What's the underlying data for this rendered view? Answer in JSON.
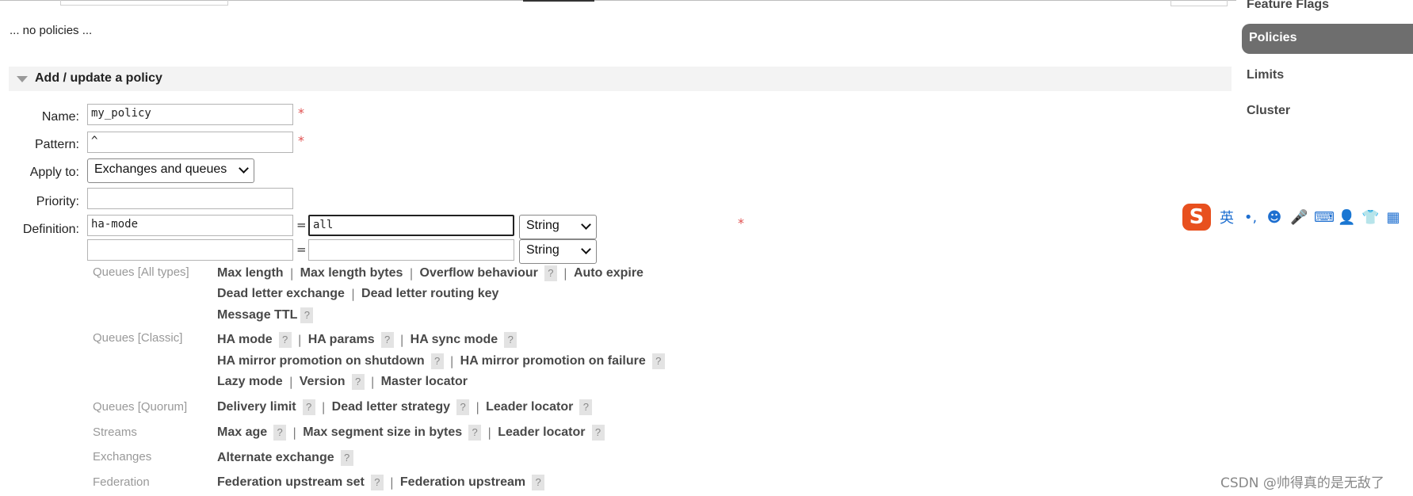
{
  "top_partial_text": "(pagination)",
  "no_policies_text": "... no policies ...",
  "section": {
    "title": "Add / update a policy"
  },
  "form": {
    "name": {
      "label": "Name:",
      "value": "my_policy",
      "required": "*"
    },
    "pattern": {
      "label": "Pattern:",
      "value": "^",
      "required": "*"
    },
    "apply_to": {
      "label": "Apply to:",
      "value": "Exchanges and queues"
    },
    "priority": {
      "label": "Priority:",
      "value": ""
    },
    "definition": {
      "label": "Definition:",
      "required": "*",
      "rows": [
        {
          "key": "ha-mode",
          "eq": "=",
          "value": "all",
          "type": "String"
        },
        {
          "key": "",
          "eq": "=",
          "value": "",
          "type": "String"
        }
      ]
    }
  },
  "groups": {
    "queues_all": {
      "title": "Queues [All types]",
      "line1": [
        "Max length",
        "Max length bytes",
        "Overflow behaviour",
        "Auto expire"
      ],
      "line2": [
        "Dead letter exchange",
        "Dead letter routing key"
      ],
      "line3": [
        "Message TTL"
      ]
    },
    "queues_classic": {
      "title": "Queues [Classic]",
      "line1": [
        "HA mode",
        "HA params",
        "HA sync mode"
      ],
      "line2": [
        "HA mirror promotion on shutdown",
        "HA mirror promotion on failure"
      ],
      "line3": [
        "Lazy mode",
        "Version",
        "Master locator"
      ]
    },
    "queues_quorum": {
      "title": "Queues [Quorum]",
      "line1": [
        "Delivery limit",
        "Dead letter strategy",
        "Leader locator"
      ]
    },
    "streams": {
      "title": "Streams",
      "line1": [
        "Max age",
        "Max segment size in bytes",
        "Leader locator"
      ]
    },
    "exchanges": {
      "title": "Exchanges",
      "line1": [
        "Alternate exchange"
      ]
    },
    "federation": {
      "title": "Federation",
      "line1": [
        "Federation upstream set",
        "Federation upstream"
      ]
    }
  },
  "help_glyph": "?",
  "separator": "|",
  "sidebar": {
    "items": [
      "Feature Flags",
      "Policies",
      "Limits",
      "Cluster"
    ],
    "active": "Policies"
  },
  "ime_toolbar": {
    "logo": "S",
    "lang": "英",
    "punct": "•,",
    "emoji": "☻",
    "mic": "🎤",
    "keyboard": "⌨",
    "user": "👤",
    "shirt": "👕",
    "grid": "▦"
  },
  "watermark": "CSDN @帅得真的是无敌了",
  "colors": {
    "active_sidebar": "#6e6e6e",
    "required": "#e05050",
    "ime_logo": "#e8501e",
    "ime_icons": "#1e6fd0"
  }
}
